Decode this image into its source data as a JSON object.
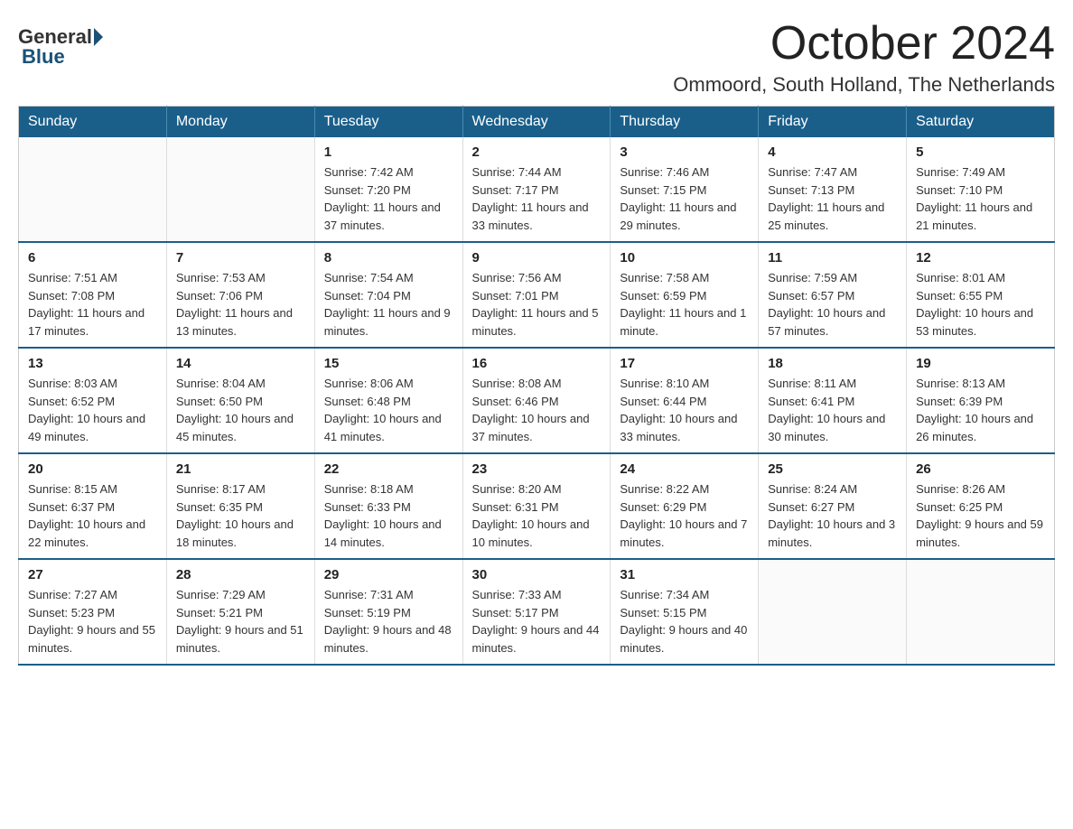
{
  "header": {
    "month_year": "October 2024",
    "location": "Ommoord, South Holland, The Netherlands",
    "logo_general": "General",
    "logo_blue": "Blue"
  },
  "weekdays": [
    "Sunday",
    "Monday",
    "Tuesday",
    "Wednesday",
    "Thursday",
    "Friday",
    "Saturday"
  ],
  "weeks": [
    [
      {
        "day": "",
        "sunrise": "",
        "sunset": "",
        "daylight": ""
      },
      {
        "day": "",
        "sunrise": "",
        "sunset": "",
        "daylight": ""
      },
      {
        "day": "1",
        "sunrise": "Sunrise: 7:42 AM",
        "sunset": "Sunset: 7:20 PM",
        "daylight": "Daylight: 11 hours and 37 minutes."
      },
      {
        "day": "2",
        "sunrise": "Sunrise: 7:44 AM",
        "sunset": "Sunset: 7:17 PM",
        "daylight": "Daylight: 11 hours and 33 minutes."
      },
      {
        "day": "3",
        "sunrise": "Sunrise: 7:46 AM",
        "sunset": "Sunset: 7:15 PM",
        "daylight": "Daylight: 11 hours and 29 minutes."
      },
      {
        "day": "4",
        "sunrise": "Sunrise: 7:47 AM",
        "sunset": "Sunset: 7:13 PM",
        "daylight": "Daylight: 11 hours and 25 minutes."
      },
      {
        "day": "5",
        "sunrise": "Sunrise: 7:49 AM",
        "sunset": "Sunset: 7:10 PM",
        "daylight": "Daylight: 11 hours and 21 minutes."
      }
    ],
    [
      {
        "day": "6",
        "sunrise": "Sunrise: 7:51 AM",
        "sunset": "Sunset: 7:08 PM",
        "daylight": "Daylight: 11 hours and 17 minutes."
      },
      {
        "day": "7",
        "sunrise": "Sunrise: 7:53 AM",
        "sunset": "Sunset: 7:06 PM",
        "daylight": "Daylight: 11 hours and 13 minutes."
      },
      {
        "day": "8",
        "sunrise": "Sunrise: 7:54 AM",
        "sunset": "Sunset: 7:04 PM",
        "daylight": "Daylight: 11 hours and 9 minutes."
      },
      {
        "day": "9",
        "sunrise": "Sunrise: 7:56 AM",
        "sunset": "Sunset: 7:01 PM",
        "daylight": "Daylight: 11 hours and 5 minutes."
      },
      {
        "day": "10",
        "sunrise": "Sunrise: 7:58 AM",
        "sunset": "Sunset: 6:59 PM",
        "daylight": "Daylight: 11 hours and 1 minute."
      },
      {
        "day": "11",
        "sunrise": "Sunrise: 7:59 AM",
        "sunset": "Sunset: 6:57 PM",
        "daylight": "Daylight: 10 hours and 57 minutes."
      },
      {
        "day": "12",
        "sunrise": "Sunrise: 8:01 AM",
        "sunset": "Sunset: 6:55 PM",
        "daylight": "Daylight: 10 hours and 53 minutes."
      }
    ],
    [
      {
        "day": "13",
        "sunrise": "Sunrise: 8:03 AM",
        "sunset": "Sunset: 6:52 PM",
        "daylight": "Daylight: 10 hours and 49 minutes."
      },
      {
        "day": "14",
        "sunrise": "Sunrise: 8:04 AM",
        "sunset": "Sunset: 6:50 PM",
        "daylight": "Daylight: 10 hours and 45 minutes."
      },
      {
        "day": "15",
        "sunrise": "Sunrise: 8:06 AM",
        "sunset": "Sunset: 6:48 PM",
        "daylight": "Daylight: 10 hours and 41 minutes."
      },
      {
        "day": "16",
        "sunrise": "Sunrise: 8:08 AM",
        "sunset": "Sunset: 6:46 PM",
        "daylight": "Daylight: 10 hours and 37 minutes."
      },
      {
        "day": "17",
        "sunrise": "Sunrise: 8:10 AM",
        "sunset": "Sunset: 6:44 PM",
        "daylight": "Daylight: 10 hours and 33 minutes."
      },
      {
        "day": "18",
        "sunrise": "Sunrise: 8:11 AM",
        "sunset": "Sunset: 6:41 PM",
        "daylight": "Daylight: 10 hours and 30 minutes."
      },
      {
        "day": "19",
        "sunrise": "Sunrise: 8:13 AM",
        "sunset": "Sunset: 6:39 PM",
        "daylight": "Daylight: 10 hours and 26 minutes."
      }
    ],
    [
      {
        "day": "20",
        "sunrise": "Sunrise: 8:15 AM",
        "sunset": "Sunset: 6:37 PM",
        "daylight": "Daylight: 10 hours and 22 minutes."
      },
      {
        "day": "21",
        "sunrise": "Sunrise: 8:17 AM",
        "sunset": "Sunset: 6:35 PM",
        "daylight": "Daylight: 10 hours and 18 minutes."
      },
      {
        "day": "22",
        "sunrise": "Sunrise: 8:18 AM",
        "sunset": "Sunset: 6:33 PM",
        "daylight": "Daylight: 10 hours and 14 minutes."
      },
      {
        "day": "23",
        "sunrise": "Sunrise: 8:20 AM",
        "sunset": "Sunset: 6:31 PM",
        "daylight": "Daylight: 10 hours and 10 minutes."
      },
      {
        "day": "24",
        "sunrise": "Sunrise: 8:22 AM",
        "sunset": "Sunset: 6:29 PM",
        "daylight": "Daylight: 10 hours and 7 minutes."
      },
      {
        "day": "25",
        "sunrise": "Sunrise: 8:24 AM",
        "sunset": "Sunset: 6:27 PM",
        "daylight": "Daylight: 10 hours and 3 minutes."
      },
      {
        "day": "26",
        "sunrise": "Sunrise: 8:26 AM",
        "sunset": "Sunset: 6:25 PM",
        "daylight": "Daylight: 9 hours and 59 minutes."
      }
    ],
    [
      {
        "day": "27",
        "sunrise": "Sunrise: 7:27 AM",
        "sunset": "Sunset: 5:23 PM",
        "daylight": "Daylight: 9 hours and 55 minutes."
      },
      {
        "day": "28",
        "sunrise": "Sunrise: 7:29 AM",
        "sunset": "Sunset: 5:21 PM",
        "daylight": "Daylight: 9 hours and 51 minutes."
      },
      {
        "day": "29",
        "sunrise": "Sunrise: 7:31 AM",
        "sunset": "Sunset: 5:19 PM",
        "daylight": "Daylight: 9 hours and 48 minutes."
      },
      {
        "day": "30",
        "sunrise": "Sunrise: 7:33 AM",
        "sunset": "Sunset: 5:17 PM",
        "daylight": "Daylight: 9 hours and 44 minutes."
      },
      {
        "day": "31",
        "sunrise": "Sunrise: 7:34 AM",
        "sunset": "Sunset: 5:15 PM",
        "daylight": "Daylight: 9 hours and 40 minutes."
      },
      {
        "day": "",
        "sunrise": "",
        "sunset": "",
        "daylight": ""
      },
      {
        "day": "",
        "sunrise": "",
        "sunset": "",
        "daylight": ""
      }
    ]
  ]
}
